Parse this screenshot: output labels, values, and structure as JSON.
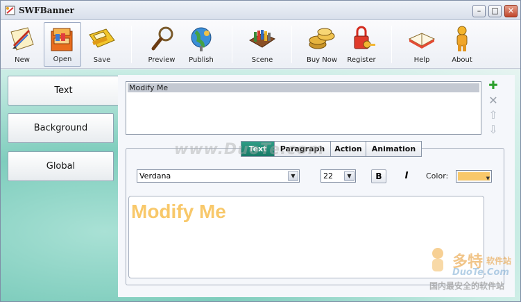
{
  "window": {
    "title": "SWFBanner",
    "min": "–",
    "max": "□",
    "close": "✕"
  },
  "toolbar": [
    {
      "id": "new",
      "label": "New",
      "icon": "new-document-icon"
    },
    {
      "id": "open",
      "label": "Open",
      "icon": "open-folder-icon"
    },
    {
      "id": "save",
      "label": "Save",
      "icon": "floppy-disk-icon"
    },
    {
      "id": "preview",
      "label": "Preview",
      "icon": "magnifier-icon"
    },
    {
      "id": "publish",
      "label": "Publish",
      "icon": "globe-icon"
    },
    {
      "id": "scene",
      "label": "Scene",
      "icon": "film-strip-icon"
    },
    {
      "id": "buynow",
      "label": "Buy Now",
      "icon": "coins-icon"
    },
    {
      "id": "register",
      "label": "Register",
      "icon": "key-lock-icon"
    },
    {
      "id": "help",
      "label": "Help",
      "icon": "book-icon"
    },
    {
      "id": "about",
      "label": "About",
      "icon": "person-icon"
    }
  ],
  "sidebar": {
    "text": "Text",
    "background": "Background",
    "global": "Global"
  },
  "list": {
    "items": [
      "Modify Me"
    ]
  },
  "tabs": {
    "text": "Text",
    "paragraph": "Paragraph",
    "action": "Action",
    "animation": "Animation"
  },
  "format": {
    "font": "Verdana",
    "size": "22",
    "bold": "B",
    "italic": "I",
    "color_label": "Color:",
    "color_value": "#f8c86a"
  },
  "preview": {
    "text": "Modify Me",
    "color": "#f8c86a"
  },
  "watermark": {
    "site": "www.DuoTe.com",
    "cn_big": "多特",
    "cn_small": "软件站",
    "domain": "DuoTe.Com",
    "slogan": "国内最安全的软件站"
  }
}
